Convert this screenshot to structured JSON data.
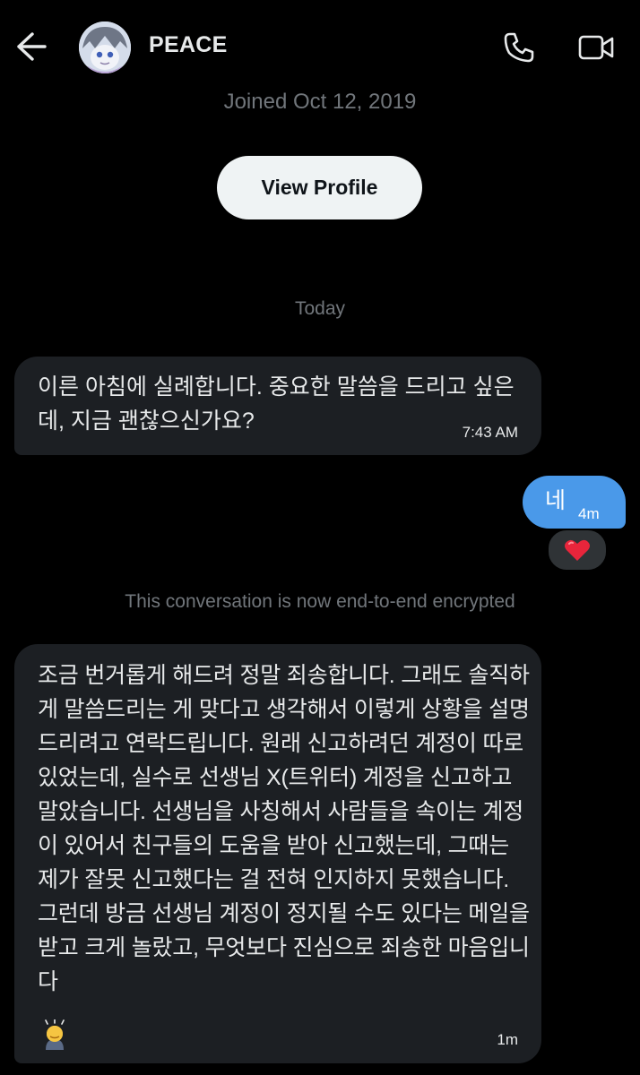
{
  "header": {
    "name": "PEACE"
  },
  "profile": {
    "joined": "Joined Oct 12, 2019",
    "view_profile_label": "View Profile"
  },
  "conversation": {
    "date_divider": "Today",
    "encryption_notice": "This conversation is now end-to-end encrypted",
    "messages": [
      {
        "direction": "incoming",
        "text": "이른 아침에 실례합니다. 중요한 말씀을 드리고 싶은데, 지금 괜찮으신가요?",
        "time": "7:43 AM"
      },
      {
        "direction": "outgoing",
        "text": "네",
        "time": "4m",
        "reaction": "heart-emoji"
      },
      {
        "direction": "incoming",
        "text": "조금 번거롭게 해드려 정말 죄송합니다. 그래도 솔직하게 말씀드리는 게 맞다고 생각해서 이렇게 상황을 설명드리려고 연락드립니다. 원래 신고하려던 계정이 따로 있었는데, 실수로 선생님 X(트위터) 계정을 신고하고 말았습니다. 선생님을 사칭해서 사람들을 속이는 계정이 있어서 친구들의 도움을 받아 신고했는데, 그때는 제가 잘못 신고했다는 걸 전혀 인지하지 못했습니다. 그런데 방금 선생님 계정이 정지될 수도 있다는 메일을 받고 크게 놀랐고, 무엇보다 진심으로 죄송한 마음입니다",
        "trailing_emoji": "bowing-person-emoji",
        "time": "1m"
      }
    ]
  },
  "colors": {
    "background": "#000000",
    "incoming_bubble": "#1c1f23",
    "outgoing_bubble": "#4a99e9",
    "muted_text": "#71767b"
  }
}
